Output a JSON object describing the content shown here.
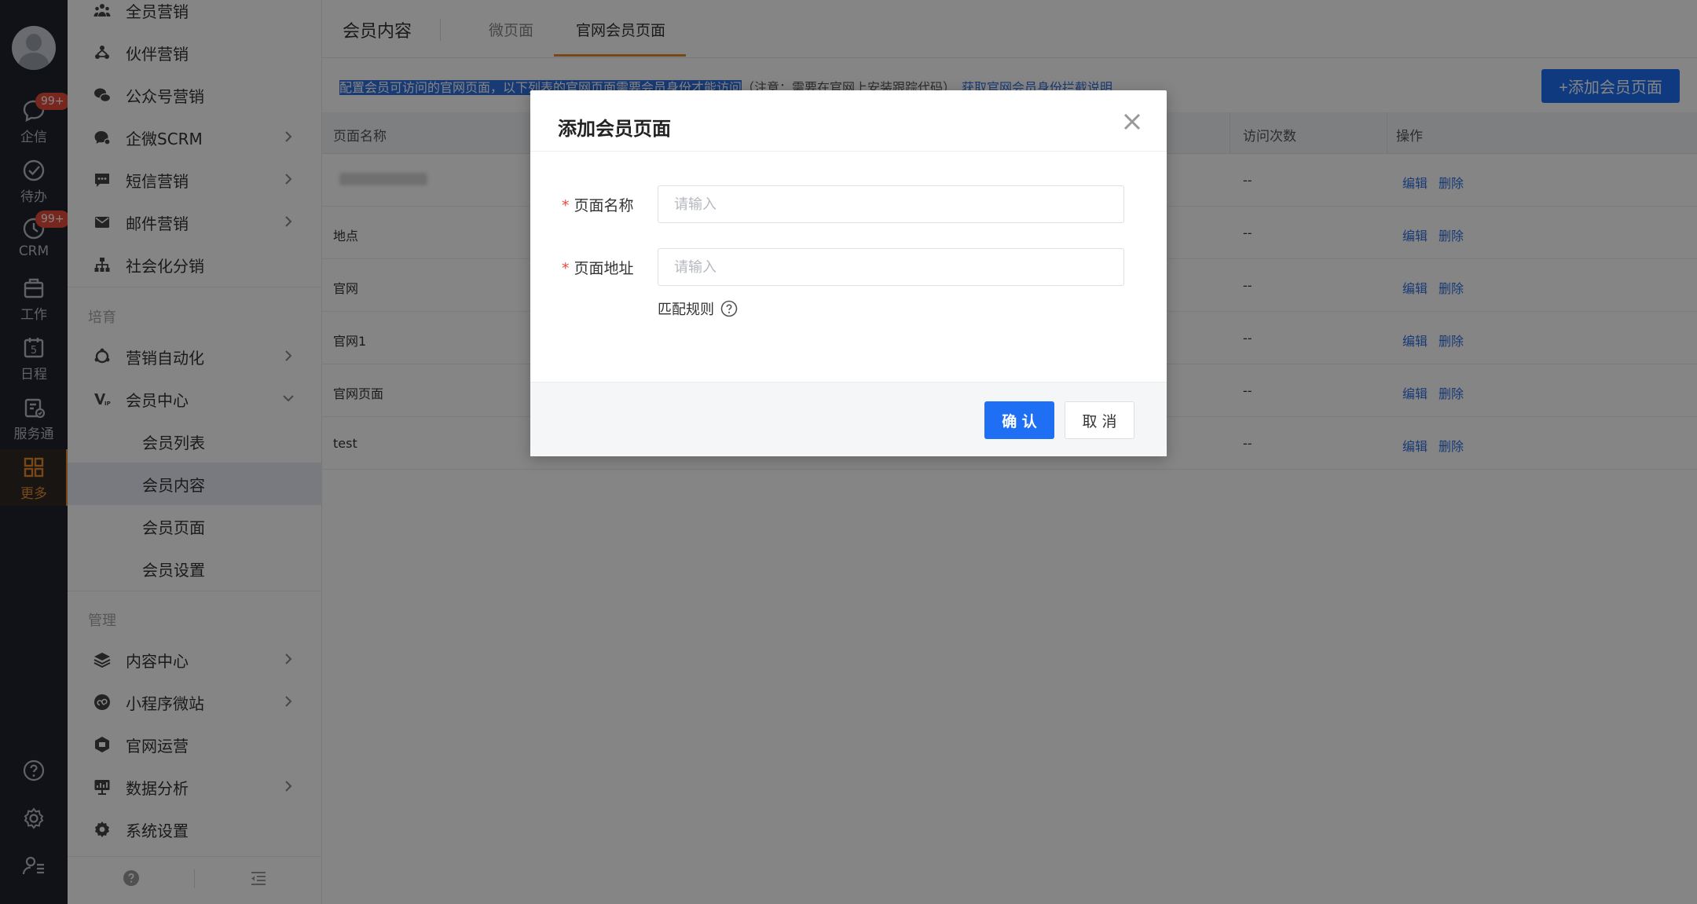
{
  "rail": {
    "items": [
      {
        "label": "企信",
        "icon": "chat-icon",
        "badge": "99+"
      },
      {
        "label": "待办",
        "icon": "todo-check-icon"
      },
      {
        "label": "CRM",
        "icon": "crm-clock-icon",
        "badge": "99+"
      },
      {
        "label": "工作",
        "icon": "briefcase-icon"
      },
      {
        "label": "日程",
        "icon": "calendar-icon",
        "day": "5"
      },
      {
        "label": "服务通",
        "icon": "service-icon"
      },
      {
        "label": "更多",
        "icon": "grid-icon"
      }
    ],
    "accent_color": "#e98a2f"
  },
  "subnav": {
    "items": [
      {
        "label": "全员营销",
        "icon": "team-icon"
      },
      {
        "label": "伙伴营销",
        "icon": "partner-icon"
      },
      {
        "label": "公众号营销",
        "icon": "wechat-icon"
      },
      {
        "label": "企微SCRM",
        "icon": "scrm-icon"
      },
      {
        "label": "短信营销",
        "icon": "sms-icon"
      },
      {
        "label": "邮件营销",
        "icon": "mail-icon"
      },
      {
        "label": "社会化分销",
        "icon": "org-tree-icon"
      },
      {
        "label": "营销自动化",
        "icon": "automation-icon"
      },
      {
        "label": "会员中心",
        "icon": "vip-icon"
      },
      {
        "label": "内容中心",
        "icon": "layers-icon"
      },
      {
        "label": "小程序微站",
        "icon": "miniapp-icon"
      },
      {
        "label": "官网运营",
        "icon": "website-icon"
      },
      {
        "label": "数据分析",
        "icon": "analytics-icon"
      },
      {
        "label": "系统设置",
        "icon": "settings-gear-icon"
      }
    ],
    "groups": {
      "nurture": "培育",
      "manage": "管理"
    },
    "member_sub": [
      "会员列表",
      "会员内容",
      "会员页面",
      "会员设置"
    ]
  },
  "main": {
    "title": "会员内容",
    "tabs": [
      "微页面",
      "官网会员页面"
    ],
    "tip_highlight": "配置会员可访问的官网页面，以下列表的官网页面需要会员身份才能访问",
    "tip_note": "（注意：需要在官网上安装跟踪代码）",
    "tip_link": "获取官网会员身份拦截说明",
    "add_button": "+添加会员页面",
    "table": {
      "headers": [
        "页面名称",
        "访问次数",
        "操作"
      ],
      "rows": [
        {
          "name": "",
          "visits": "--"
        },
        {
          "name": "地点",
          "visits": "--"
        },
        {
          "name": "官网",
          "visits": "--"
        },
        {
          "name": "官网1",
          "visits": "--"
        },
        {
          "name": "官网页面",
          "visits": "--"
        },
        {
          "name": "test",
          "visits": "--"
        }
      ],
      "edit": "编辑",
      "delete": "删除"
    }
  },
  "modal": {
    "title": "添加会员页面",
    "fields": [
      {
        "label": "页面名称",
        "placeholder": "请输入",
        "value": ""
      },
      {
        "label": "页面地址",
        "placeholder": "请输入",
        "value": ""
      }
    ],
    "rule_label": "匹配规则",
    "confirm": "确 认",
    "cancel": "取 消"
  }
}
